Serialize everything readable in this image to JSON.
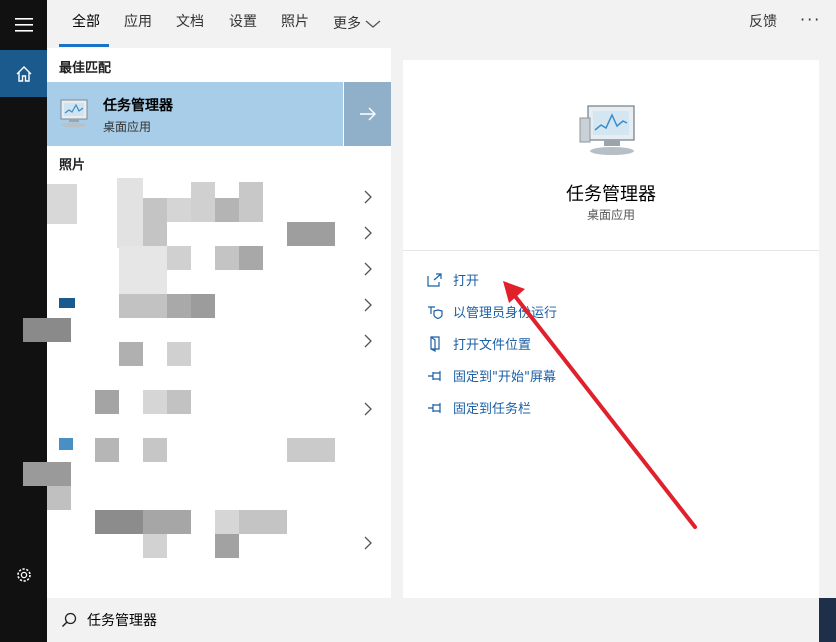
{
  "tabs": [
    {
      "label": "全部",
      "active": true
    },
    {
      "label": "应用",
      "active": false
    },
    {
      "label": "文档",
      "active": false
    },
    {
      "label": "设置",
      "active": false
    },
    {
      "label": "照片",
      "active": false
    },
    {
      "label": "更多",
      "active": false
    }
  ],
  "topbar": {
    "feedback_label": "反馈",
    "more_dots": "···"
  },
  "left": {
    "best_match_heading": "最佳匹配",
    "best_match": {
      "title": "任务管理器",
      "subtitle": "桌面应用"
    },
    "photos_heading": "照片"
  },
  "detail": {
    "app_title": "任务管理器",
    "app_subtitle": "桌面应用",
    "actions": [
      {
        "label": "打开",
        "icon": "open-icon"
      },
      {
        "label": "以管理员身份运行",
        "icon": "shield-icon"
      },
      {
        "label": "打开文件位置",
        "icon": "folder-icon"
      },
      {
        "label": "固定到\"开始\"屏幕",
        "icon": "pin-icon"
      },
      {
        "label": "固定到任务栏",
        "icon": "pin-icon"
      }
    ]
  },
  "search": {
    "query": "任务管理器"
  },
  "colors": {
    "accent": "#1a73c4",
    "selected_bg": "#a8cde8",
    "annotation_arrow": "#e0202a"
  }
}
